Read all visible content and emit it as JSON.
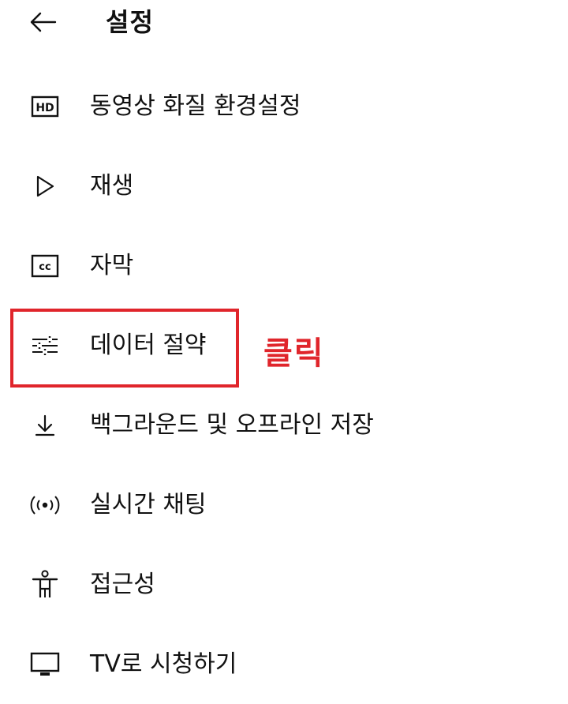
{
  "header": {
    "back_icon": "arrow-left-icon",
    "title": "설정"
  },
  "menu": {
    "items": [
      {
        "id": "video-quality",
        "label": "동영상 화질 환경설정",
        "icon": "hd-icon"
      },
      {
        "id": "playback",
        "label": "재생",
        "icon": "play-outline-icon"
      },
      {
        "id": "captions",
        "label": "자막",
        "icon": "closed-caption-icon"
      },
      {
        "id": "data-saving",
        "label": "데이터 절약",
        "icon": "sliders-icon"
      },
      {
        "id": "background-offline",
        "label": "백그라운드 및 오프라인 저장",
        "icon": "download-arrow-icon"
      },
      {
        "id": "live-chat",
        "label": "실시간 채팅",
        "icon": "broadcast-icon"
      },
      {
        "id": "accessibility",
        "label": "접근성",
        "icon": "accessibility-person-icon"
      },
      {
        "id": "watch-on-tv",
        "label": "TV로 시청하기",
        "icon": "tv-icon"
      }
    ]
  },
  "annotation": {
    "text": "클릭",
    "color": "#e0252b",
    "target": "data-saving"
  }
}
